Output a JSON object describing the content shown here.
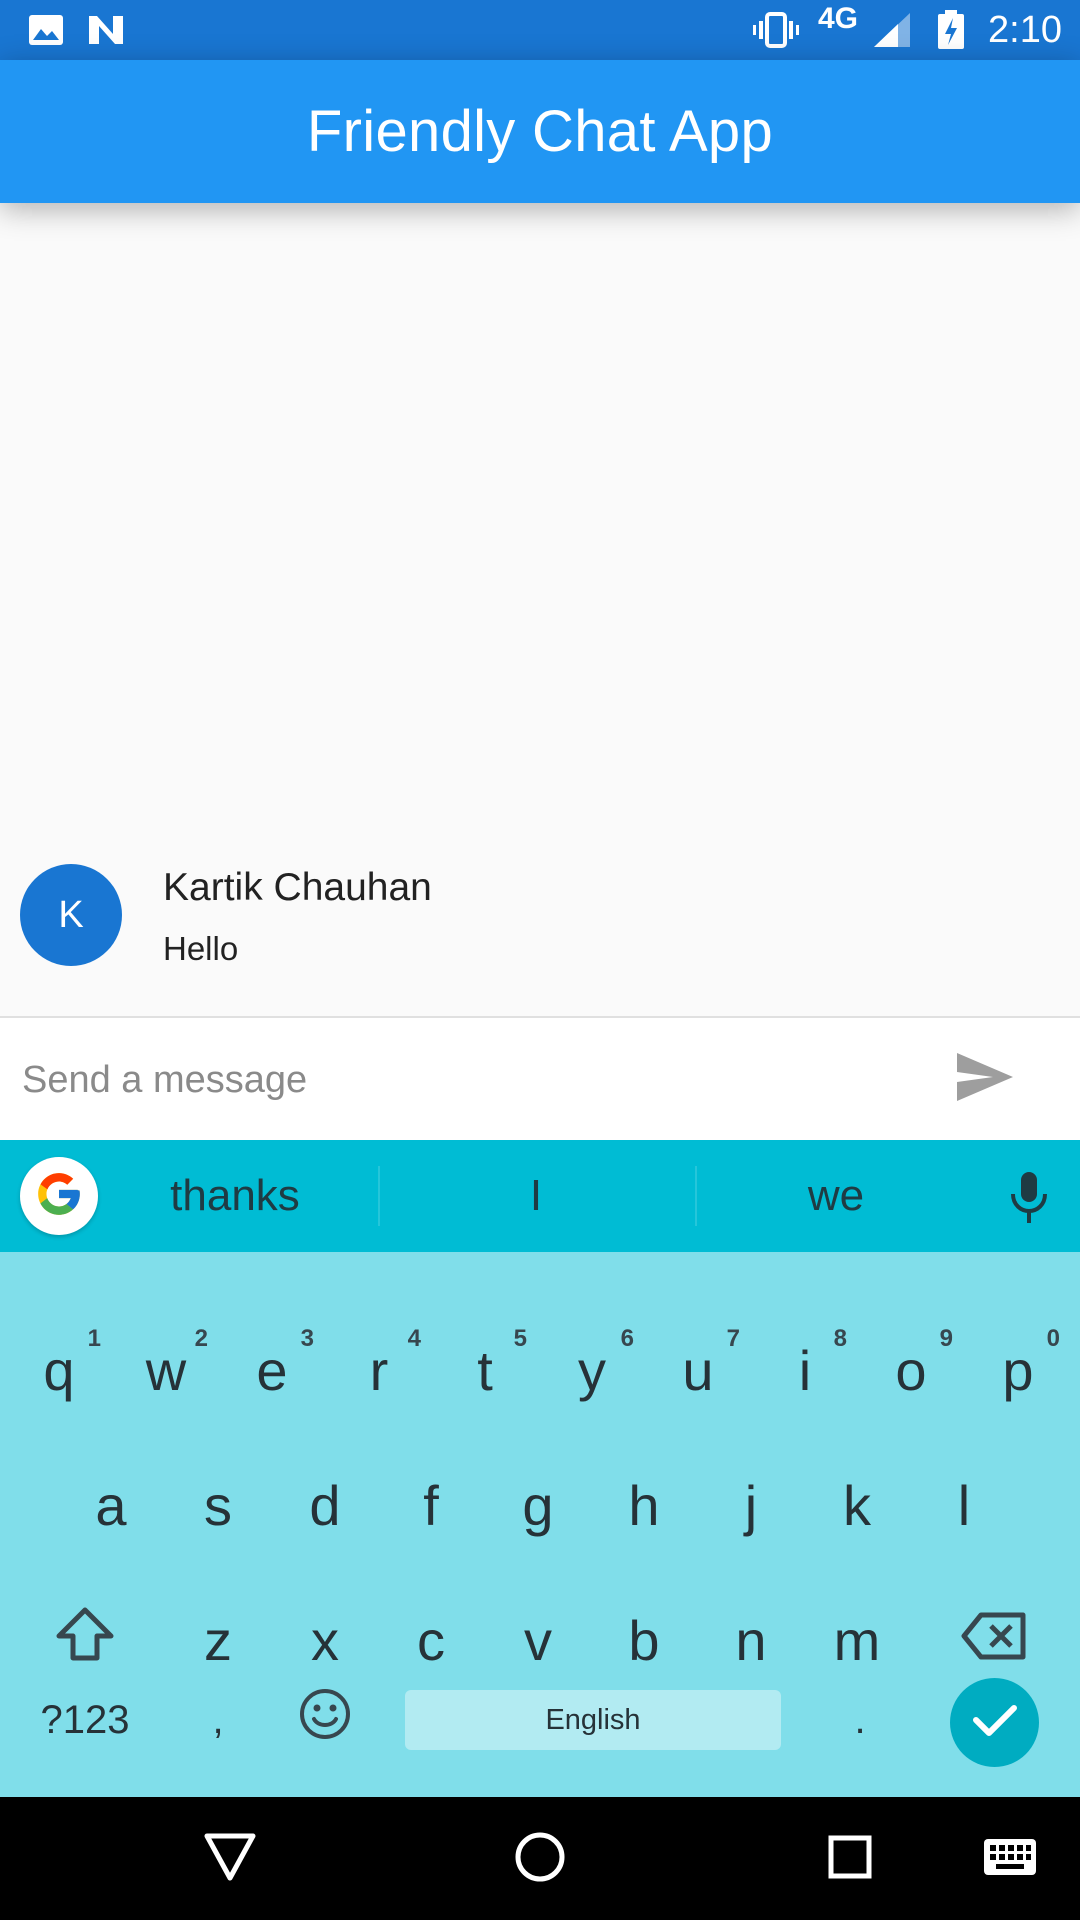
{
  "status_bar": {
    "time": "2:10",
    "network": "4G",
    "icons": [
      "image-icon",
      "n-notification-icon",
      "vibrate-icon",
      "signal-icon",
      "battery-charging-icon"
    ]
  },
  "app_bar": {
    "title": "Friendly Chat App"
  },
  "messages": [
    {
      "avatar_initial": "K",
      "sender": "Kartik Chauhan",
      "text": "Hello"
    }
  ],
  "composer": {
    "placeholder": "Send a message",
    "value": "",
    "send_icon": "send-icon"
  },
  "keyboard": {
    "suggestions": [
      "thanks",
      "I",
      "we"
    ],
    "row1": [
      {
        "k": "q",
        "h": "1"
      },
      {
        "k": "w",
        "h": "2"
      },
      {
        "k": "e",
        "h": "3"
      },
      {
        "k": "r",
        "h": "4"
      },
      {
        "k": "t",
        "h": "5"
      },
      {
        "k": "y",
        "h": "6"
      },
      {
        "k": "u",
        "h": "7"
      },
      {
        "k": "i",
        "h": "8"
      },
      {
        "k": "o",
        "h": "9"
      },
      {
        "k": "p",
        "h": "0"
      }
    ],
    "row2": [
      "a",
      "s",
      "d",
      "f",
      "g",
      "h",
      "j",
      "k",
      "l"
    ],
    "row3": [
      "z",
      "x",
      "c",
      "v",
      "b",
      "n",
      "m"
    ],
    "symbols_label": "?123",
    "comma": ",",
    "space_label": "English",
    "period": ".",
    "accent_color": "#00acc1",
    "suggestion_bar_color": "#00bcd4",
    "key_area_color": "#80deea"
  },
  "colors": {
    "app_bar": "#2196f3",
    "status_bar": "#1976d2",
    "avatar": "#1976d2"
  }
}
